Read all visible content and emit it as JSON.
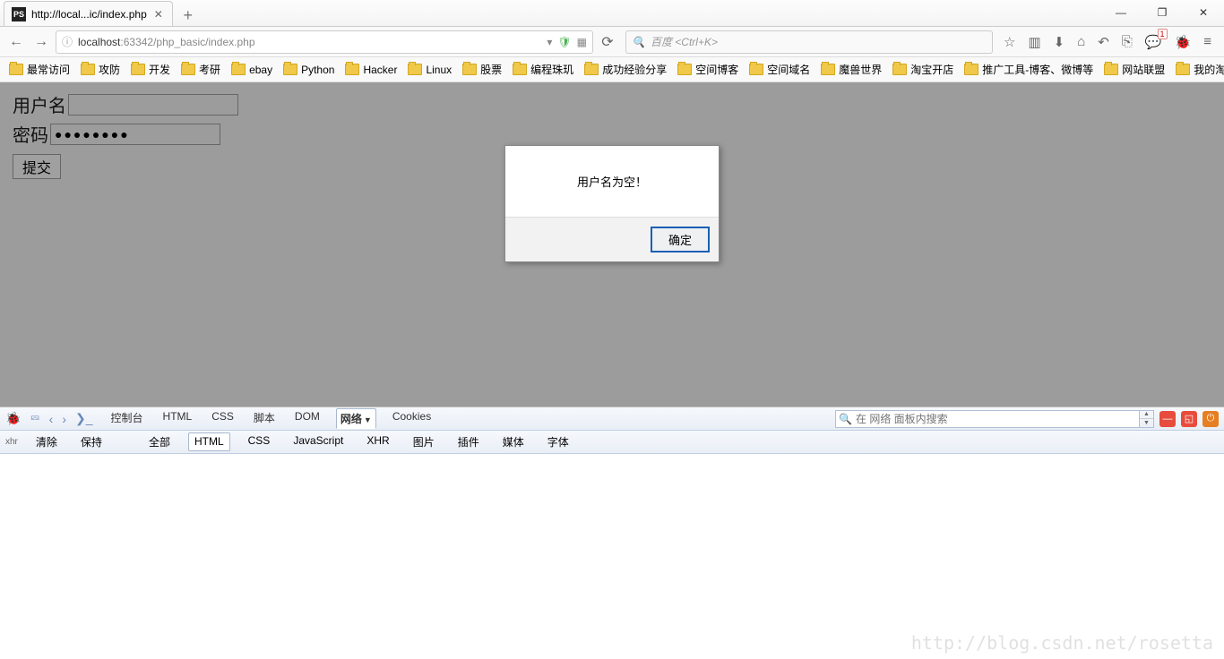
{
  "tab": {
    "title": "http://local...ic/index.php"
  },
  "url": {
    "host": "localhost",
    "port": ":63342",
    "path": "/php_basic/index.php"
  },
  "search": {
    "placeholder": "百度 <Ctrl+K>"
  },
  "bookmarks": [
    "最常访问",
    "攻防",
    "开发",
    "考研",
    "ebay",
    "Python",
    "Hacker",
    "Linux",
    "股票",
    "编程珠玑",
    "成功经验分享",
    "空间博客",
    "空间域名",
    "魔兽世界",
    "淘宝开店",
    "推广工具-博客、微博等",
    "网站联盟",
    "我的淘宝"
  ],
  "form": {
    "username_label": "用户名",
    "password_label": "密码",
    "password_value": "●●●●●●●●",
    "submit_label": "提交"
  },
  "alert": {
    "message": "用户名为空！",
    "ok": "确定"
  },
  "devtools": {
    "tabs1": [
      "控制台",
      "HTML",
      "CSS",
      "脚本",
      "DOM",
      "网络",
      "Cookies"
    ],
    "active1": "网络",
    "search_placeholder": "在 网络 面板内搜索",
    "tabs2_left": [
      "清除",
      "保持"
    ],
    "tabs2_right": [
      "全部",
      "HTML",
      "CSS",
      "JavaScript",
      "XHR",
      "图片",
      "插件",
      "媒体",
      "字体"
    ],
    "active2": "HTML"
  },
  "watermark": "http://blog.csdn.net/rosetta"
}
